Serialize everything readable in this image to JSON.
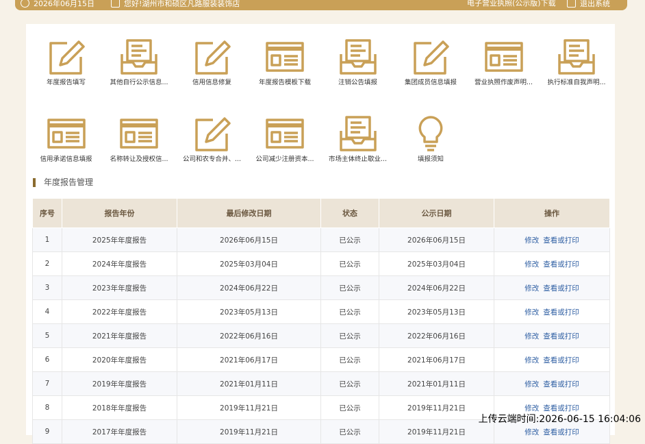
{
  "topbar": {
    "date": "2026年06月15日",
    "notice": "您好!湖州市和硕区凡路服装装饰店",
    "download": "电子营业执照(公示版)下载",
    "logout": "退出系统"
  },
  "tiles": [
    {
      "label": "年度报告填写",
      "icon": "pencil-form-icon"
    },
    {
      "label": "其他自行公示信息...",
      "icon": "inbox-icon"
    },
    {
      "label": "信用信息修复",
      "icon": "pencil-form-icon"
    },
    {
      "label": "年度报告模板下载",
      "icon": "template-icon"
    },
    {
      "label": "注销公告填报",
      "icon": "inbox-icon"
    },
    {
      "label": "集团成员信息填报",
      "icon": "pencil-form-icon"
    },
    {
      "label": "营业执照作废声明...",
      "icon": "template-icon"
    },
    {
      "label": "执行标准自我声明...",
      "icon": "inbox-icon"
    },
    {
      "label": "信用承诺信息填报",
      "icon": "template-icon"
    },
    {
      "label": "名称转让及授权信...",
      "icon": "template-icon"
    },
    {
      "label": "公司和农专合并、...",
      "icon": "pencil-form-icon"
    },
    {
      "label": "公司减少注册资本...",
      "icon": "template-icon"
    },
    {
      "label": "市场主体终止歇业...",
      "icon": "inbox-icon"
    },
    {
      "label": "填报须知",
      "icon": "lightbulb-icon"
    }
  ],
  "section_title": "年度报告管理",
  "table": {
    "headers": [
      "序号",
      "报告年份",
      "最后修改日期",
      "状态",
      "公示日期",
      "操作"
    ],
    "edit_label": "修改",
    "view_label": "查看或打印",
    "rows": [
      [
        "1",
        "2025年年度报告",
        "2026年06月15日",
        "已公示",
        "2026年06月15日"
      ],
      [
        "2",
        "2024年年度报告",
        "2025年03月04日",
        "已公示",
        "2025年03月04日"
      ],
      [
        "3",
        "2023年年度报告",
        "2024年06月22日",
        "已公示",
        "2024年06月22日"
      ],
      [
        "4",
        "2022年年度报告",
        "2023年05月13日",
        "已公示",
        "2023年05月13日"
      ],
      [
        "5",
        "2021年年度报告",
        "2022年06月16日",
        "已公示",
        "2022年06月16日"
      ],
      [
        "6",
        "2020年年度报告",
        "2021年06月17日",
        "已公示",
        "2021年06月17日"
      ],
      [
        "7",
        "2019年年度报告",
        "2021年01月11日",
        "已公示",
        "2021年01月11日"
      ],
      [
        "8",
        "2018年年度报告",
        "2019年11月21日",
        "已公示",
        "2019年11月21日"
      ],
      [
        "9",
        "2017年年度报告",
        "2019年11月21日",
        "已公示",
        "2019年11月21日"
      ]
    ]
  },
  "watermark": "上传云端时间:2026-06-15 16:04:06",
  "colors": {
    "accent": "#c9a057",
    "header_bg": "#ece4d7",
    "link": "#2f5fa3"
  }
}
